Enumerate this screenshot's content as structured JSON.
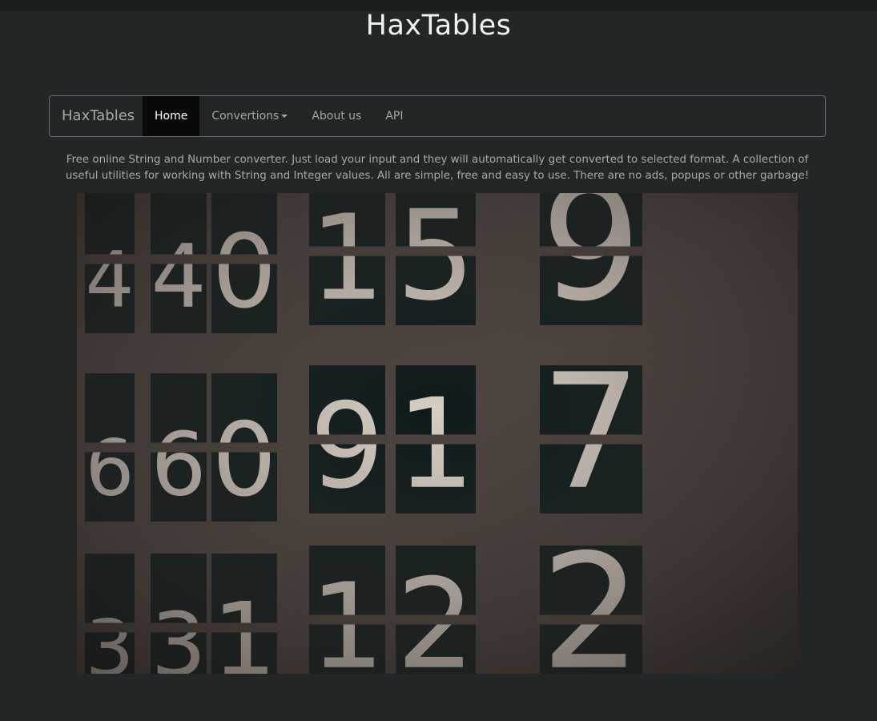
{
  "header": {
    "title": "HaxTables"
  },
  "navbar": {
    "brand": "HaxTables",
    "items": [
      {
        "label": "Home",
        "active": true
      },
      {
        "label": "Convertions",
        "dropdown": true
      },
      {
        "label": "About us"
      },
      {
        "label": "API"
      }
    ]
  },
  "intro": {
    "text": "Free online String and Number converter. Just load your input and they will automatically get converted to selected format. A collection of useful utilities for working with String and Integer values. All are simple, free and easy to use. There are no ads, popups or other garbage!"
  },
  "hero": {
    "digits_row1": [
      "4",
      "4",
      "0",
      "1",
      "5",
      "9"
    ],
    "digits_row2": [
      "6",
      "6",
      "0",
      "9",
      "1",
      "7"
    ],
    "digits_row3": [
      "3",
      "3",
      "1",
      "1",
      "2",
      "2"
    ]
  },
  "colors": {
    "background": "#222626",
    "navbar_border": "#6a6d70",
    "active_nav": "#090909",
    "text_muted": "#a9a9a9",
    "title": "#f2f2f2"
  }
}
